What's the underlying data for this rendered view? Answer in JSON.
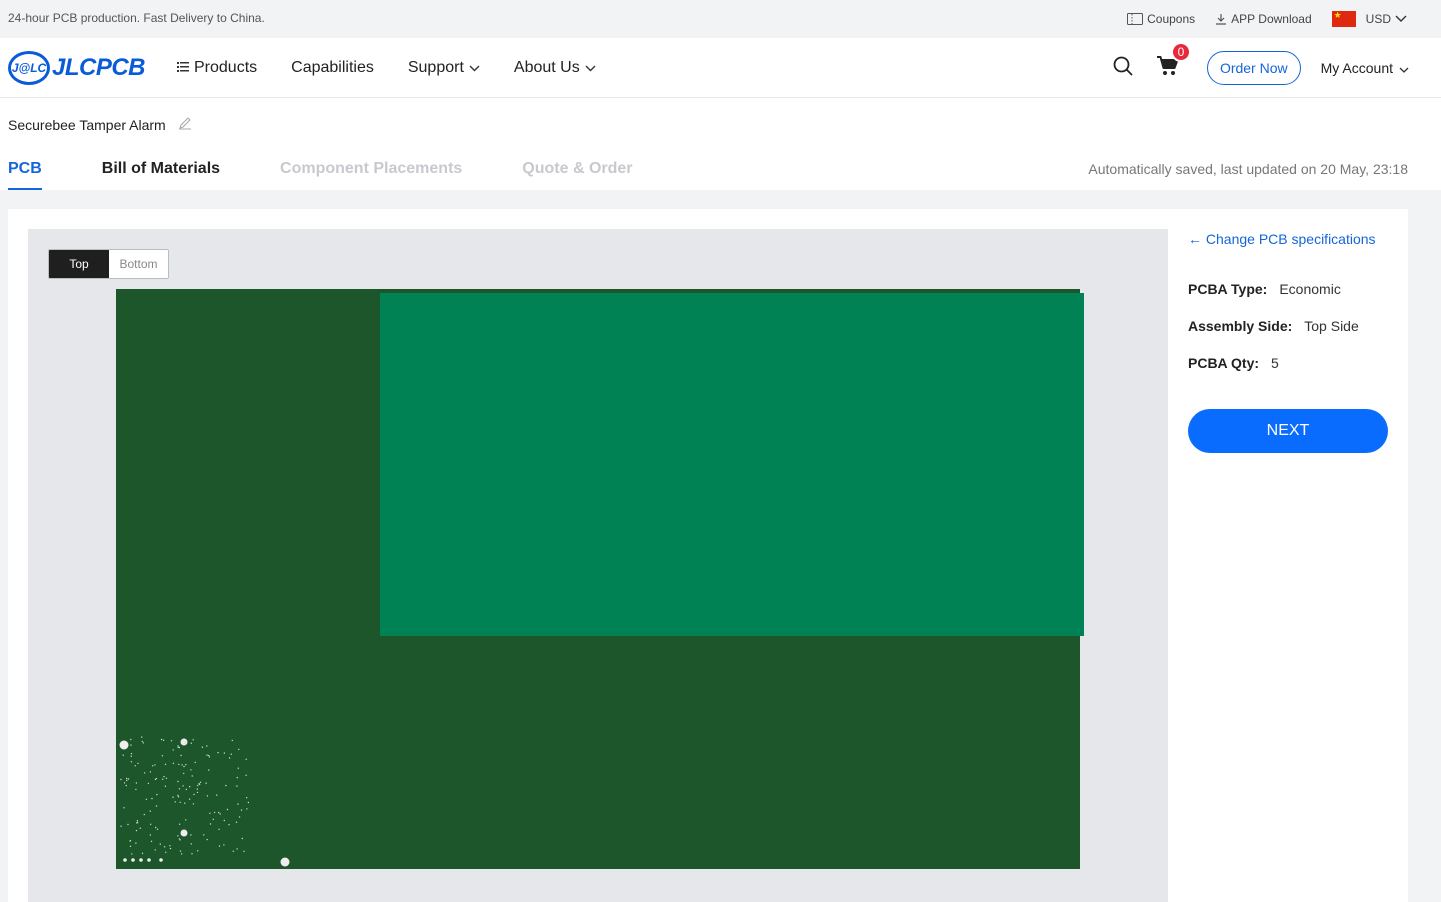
{
  "topbar": {
    "promo": "24-hour PCB production. Fast Delivery to China.",
    "coupons": "Coupons",
    "app_download": "APP Download",
    "currency": "USD"
  },
  "nav": {
    "logo_badge": "J@LC",
    "logo_text": "JLCPCB",
    "products": "Products",
    "capabilities": "Capabilities",
    "support": "Support",
    "about": "About Us",
    "cart_count": "0",
    "order_now": "Order Now",
    "account": "My Account"
  },
  "project": {
    "title": "Securebee Tamper Alarm"
  },
  "tabs": [
    {
      "label": "PCB",
      "state": "active"
    },
    {
      "label": "Bill of Materials",
      "state": "done"
    },
    {
      "label": "Component Placements",
      "state": "disabled"
    },
    {
      "label": "Quote & Order",
      "state": "disabled"
    }
  ],
  "autosave": "Automatically saved, last updated on 20 May, 23:18",
  "viewer": {
    "top_label": "Top",
    "bottom_label": "Bottom",
    "selected_side": "Top",
    "board_color": "#1d562b",
    "pad_color": "#008255"
  },
  "specs": {
    "change_link": "← Change PCB specifications",
    "pcba_type_label": "PCBA Type:",
    "pcba_type_value": "Economic",
    "assembly_side_label": "Assembly Side:",
    "assembly_side_value": "Top Side",
    "qty_label": "PCBA Qty:",
    "qty_value": "5",
    "next_label": "NEXT"
  },
  "colors": {
    "accent": "#1565d8",
    "next_button": "#0a6cff",
    "cart_badge": "#e8293b"
  }
}
